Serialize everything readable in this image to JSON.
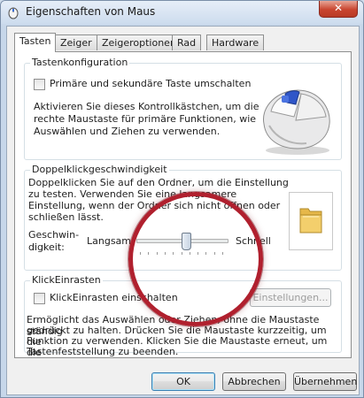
{
  "window": {
    "title": "Eigenschaften von Maus",
    "close_label": "✕"
  },
  "tabs": [
    {
      "label": "Tasten",
      "active": true
    },
    {
      "label": "Zeiger"
    },
    {
      "label": "Zeigeroptionen"
    },
    {
      "label": "Rad"
    },
    {
      "label": "Hardware"
    }
  ],
  "button_config": {
    "legend": "Tastenkonfiguration",
    "checkbox_label": "Primäre und sekundäre Taste umschalten",
    "checked": false,
    "description_lines": [
      "Aktivieren Sie dieses Kontrollkästchen, um die",
      "rechte Maustaste für primäre Funktionen, wie",
      "Auswählen und Ziehen zu verwenden."
    ]
  },
  "double_click": {
    "legend": "Doppelklickgeschwindigkeit",
    "description_lines": [
      "Doppelklicken Sie auf den Ordner, um die Einstellung",
      "zu testen. Verwenden Sie eine langsamere",
      "Einstellung, wenn der Ordner sich nicht öffnen oder",
      "schließen lässt."
    ],
    "speed_label_line1": "Geschwin-",
    "speed_label_line2": "digkeit:",
    "slow_label": "Langsam",
    "fast_label": "Schnell",
    "speed_fraction": 0.55
  },
  "click_lock": {
    "legend": "KlickEinrasten",
    "checkbox_label": "KlickEinrasten einschalten",
    "checked": false,
    "settings_button": "Einstellungen...",
    "description_lines": [
      "Ermöglicht das Auswählen oder Ziehen, ohne die Maustaste ständig",
      "gedrückt zu halten. Drücken Sie die Maustaste kurzzeitig, um die",
      "Funktion zu verwenden. Klicken Sie die Maustaste erneut, um die",
      "Tastenfeststellung zu beenden."
    ]
  },
  "footer": {
    "ok": "OK",
    "cancel": "Abbrechen",
    "apply": "Übernehmen"
  },
  "colors": {
    "highlight_ring": "#b0202e"
  }
}
